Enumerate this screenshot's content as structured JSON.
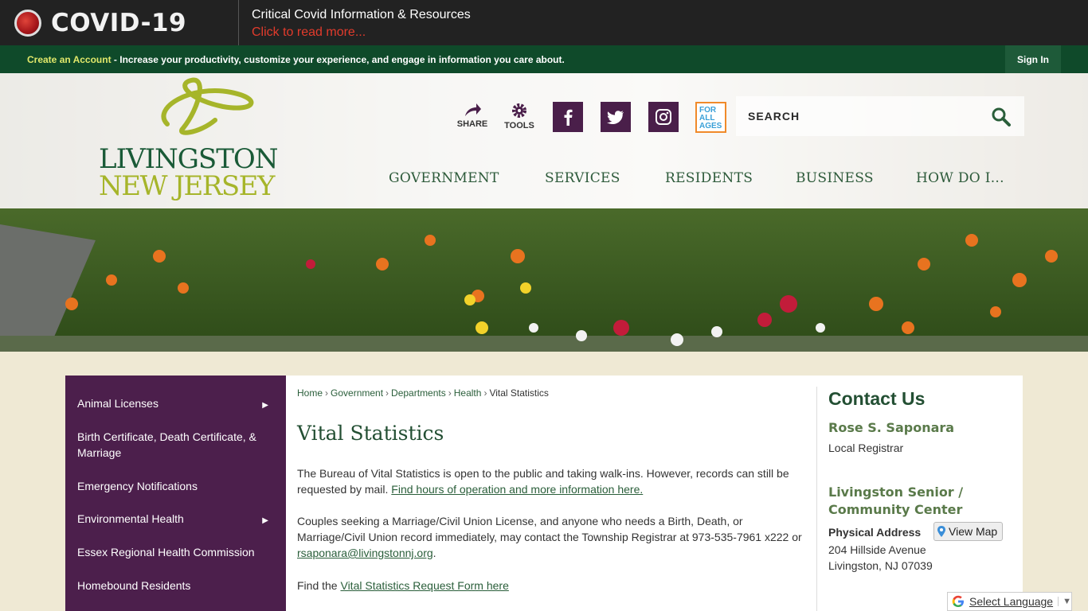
{
  "covid": {
    "title": "COVID-19",
    "headline": "Critical Covid Information & Resources",
    "link": "Click to read more..."
  },
  "account": {
    "create_link": "Create an Account",
    "message": " - Increase your productivity, customize your experience, and engage in information you care about.",
    "sign_in": "Sign In"
  },
  "logo": {
    "line1": "LIVINGSTON",
    "line2": "NEW JERSEY"
  },
  "tools": {
    "share": "SHARE",
    "tools": "TOOLS",
    "ages_badge": "FOR ALL AGES"
  },
  "search": {
    "label": "SEARCH"
  },
  "nav": [
    "GOVERNMENT",
    "SERVICES",
    "RESIDENTS",
    "BUSINESS",
    "HOW DO I..."
  ],
  "sidebar": {
    "items": [
      {
        "label": "Animal Licenses"
      },
      {
        "label": "Birth Certificate, Death Certificate, & Marriage"
      },
      {
        "label": "Emergency Notifications"
      },
      {
        "label": "Environmental Health"
      },
      {
        "label": "Essex Regional Health Commission"
      },
      {
        "label": "Homebound Residents"
      }
    ],
    "arrow": "▶"
  },
  "breadcrumb": {
    "home": "Home",
    "government": "Government",
    "departments": "Departments",
    "health": "Health",
    "current": "Vital Statistics",
    "sep": "›"
  },
  "page": {
    "title": "Vital Statistics",
    "p1": "The Bureau of Vital Statistics is open to the public and taking walk-ins. However, records can still be requested by mail.",
    "p1_link": "Find hours of operation and more information here.",
    "p2": "Couples seeking a Marriage/Civil Union License, and anyone who needs a Birth, Death, or Marriage/Civil Union record immediately, may contact the Township Registrar at 973-535-7961 x222 or",
    "p2_email": "rsaponara@livingstonnj.org",
    "p2_end": ".",
    "p3": "Find the",
    "p3_link": "Vital Statistics Request Form here"
  },
  "contact": {
    "heading": "Contact Us",
    "name": "Rose S. Saponara",
    "role": "Local Registrar",
    "location": "Livingston Senior / Community Center",
    "address_label": "Physical Address",
    "view_map": "View Map",
    "street": "204 Hillside Avenue",
    "city": "Livingston, NJ 07039"
  },
  "translate": {
    "label": "Select Language",
    "caret": "▼"
  },
  "colors": {
    "brand_green": "#0f4a2a",
    "sidebar_purple": "#4c1f4c",
    "covid_red": "#e23b2c"
  }
}
